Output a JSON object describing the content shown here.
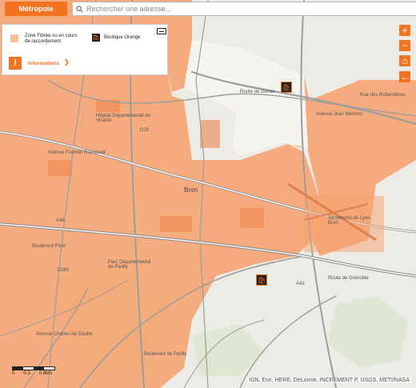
{
  "toolbar": {
    "metro_label": "Métropole",
    "search_placeholder": "Rechercher une adresse..."
  },
  "legend": {
    "zone_label": "Zone Fibrée ou en cours de raccordement",
    "shop_label": "Boutique Orange",
    "info_label": "Informations",
    "shop_icon": "shopping-bag-icon",
    "info_icon": "exclamation-icon"
  },
  "controls": {
    "zoom_in": "+",
    "zoom_out": "−",
    "home": "⌂",
    "back": "←"
  },
  "scale": {
    "ticks": [
      "0",
      "0.3",
      "0.6km"
    ]
  },
  "attribution": "IGN, Esri, HERE, DeLorme, INCREMENT P, USGS, METI/NASA",
  "map_labels": {
    "bron": "Bron",
    "hopital": "Hôpital Départemental du Vinatier",
    "parc": "Parc Départemental de Parilly",
    "aerodrome": "Aérodrome de Lyon-Bron",
    "d83": "D383",
    "a43": "A43",
    "route_genas": "Route de Genas",
    "rue_roberdieres": "Rue des Roberdières",
    "ave_rosellette": "Avenue Franklin Roosevelt",
    "bd_pinel": "Boulevard Pinel",
    "route_grenoble": "Route de Grenoble",
    "a46": "A46",
    "d29": "D29",
    "rue_mermoz": "Avenue Jean Mermoz",
    "bd_parilly": "Boulevard de Parilly",
    "ave_charles_gaulle": "Avenue Charles de Gaulle"
  },
  "colors": {
    "accent": "#f47321",
    "fiber_zone": "#f7a16b",
    "map_bg": "#ecebe6"
  }
}
